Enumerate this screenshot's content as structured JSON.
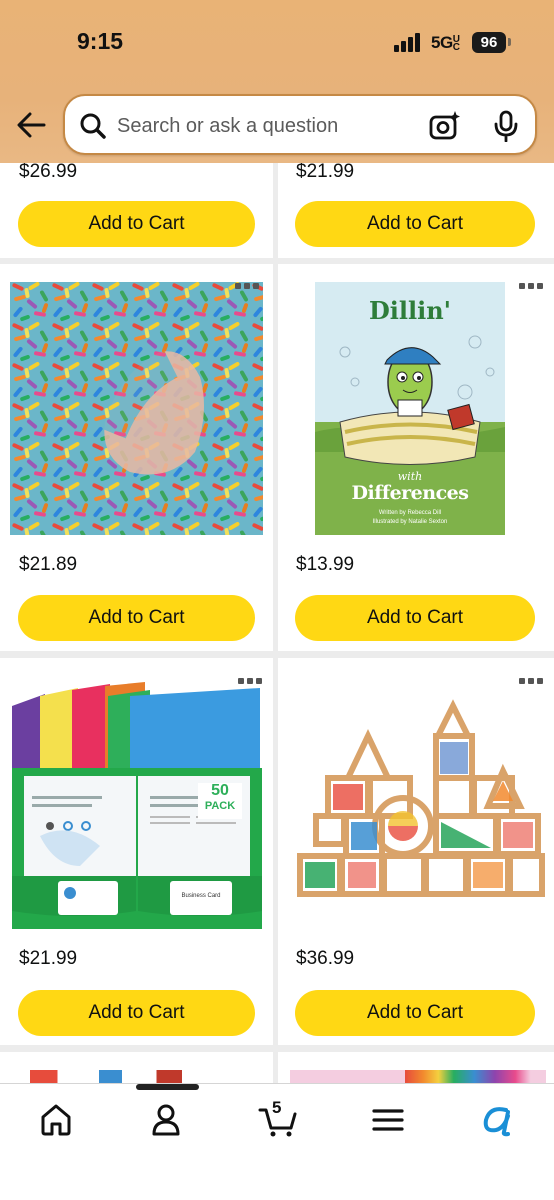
{
  "status_bar": {
    "time": "9:15",
    "network": "5G",
    "network_suffix": "UC",
    "battery": "96"
  },
  "search": {
    "placeholder": "Search or ask a question"
  },
  "products": [
    {
      "price": "$26.99",
      "button": "Add to Cart"
    },
    {
      "price": "$21.99",
      "button": "Add to Cart"
    },
    {
      "price": "$21.89",
      "button": "Add to Cart"
    },
    {
      "price": "$13.99",
      "button": "Add to Cart",
      "book": {
        "title_top": "Dillin'",
        "title_mid": "with",
        "title_bottom": "Differences",
        "author": "Written by Rebecca Dill",
        "illustrator": "Illustrated by Natalie Sexton"
      }
    },
    {
      "price": "$21.99",
      "button": "Add to Cart",
      "folder": {
        "badge_num": "50",
        "badge_text": "PACK",
        "card_label": "Business Card"
      }
    },
    {
      "price": "$36.99",
      "button": "Add to Cart"
    }
  ],
  "bottom_nav": {
    "cart_count": "5"
  },
  "colors": {
    "header": "#e7b27a",
    "add_to_cart": "#ffd814",
    "card_bg": "#ffffff",
    "page_bg": "#ececec"
  }
}
